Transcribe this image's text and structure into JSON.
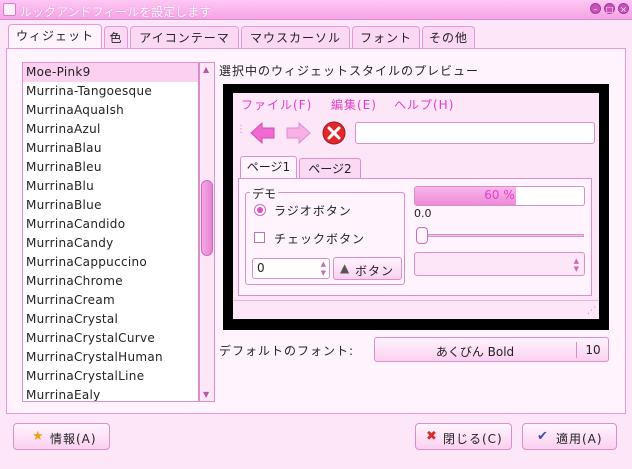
{
  "window": {
    "title": "ルックアンドフィールを設定します",
    "icon": "window-icon",
    "controls": [
      "minimize",
      "maximize",
      "close"
    ]
  },
  "tabs": [
    {
      "label": "ウィジェット",
      "active": true
    },
    {
      "label": "色",
      "active": false
    },
    {
      "label": "アイコンテーマ",
      "active": false
    },
    {
      "label": "マウスカーソル",
      "active": false
    },
    {
      "label": "フォント",
      "active": false
    },
    {
      "label": "その他",
      "active": false
    }
  ],
  "widget_list": {
    "items": [
      "Moe-Pink9",
      "Murrina-Tangoesque",
      "MurrinaAquaIsh",
      "MurrinaAzul",
      "MurrinaBlau",
      "MurrinaBleu",
      "MurrinaBlu",
      "MurrinaBlue",
      "MurrinaCandido",
      "MurrinaCandy",
      "MurrinaCappuccino",
      "MurrinaChrome",
      "MurrinaCream",
      "MurrinaCrystal",
      "MurrinaCrystalCurve",
      "MurrinaCrystalHuman",
      "MurrinaCrystalLine",
      "MurrinaEaly"
    ],
    "selected": "Moe-Pink9"
  },
  "preview": {
    "label": "選択中のウィジェットスタイルのプレビュー",
    "menu": [
      "ファイル(F)",
      "編集(E)",
      "ヘルプ(H)"
    ],
    "toolbar_icons": [
      "back-arrow-icon",
      "forward-arrow-icon",
      "stop-icon"
    ],
    "page_tabs": [
      {
        "label": "ページ1",
        "active": true
      },
      {
        "label": "ページ2",
        "active": false
      }
    ],
    "demo_label": "デモ",
    "radio_label": "ラジオボタン",
    "check_label": "チェックボタン",
    "spin_value": "0",
    "button_label": "ボタン",
    "progress": {
      "value": 0.6,
      "text": "60 %"
    },
    "scale_value": "0.0",
    "accent_color": "#e040c8"
  },
  "font_row": {
    "label": "デフォルトのフォント:",
    "font_name": "あくびん Bold",
    "font_size": "10"
  },
  "buttons": {
    "info": "情報(A)",
    "close": "閉じる(C)",
    "apply": "適用(A)"
  }
}
